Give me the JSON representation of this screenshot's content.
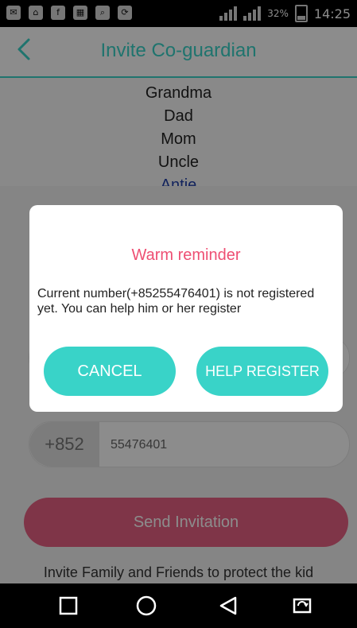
{
  "status_bar": {
    "battery": "32%",
    "time": "14:25",
    "icons": [
      "message-icon",
      "wifi-icon",
      "facebook-icon",
      "sim-icon",
      "search-icon",
      "sync-icon",
      "signal-icon",
      "battery-icon"
    ]
  },
  "header": {
    "title": "Invite Co-guardian",
    "back_icon": "back-arrow-icon"
  },
  "picker": {
    "items": [
      "Grandma",
      "Dad",
      "Mom",
      "Uncle",
      "Antie"
    ],
    "selected_index": 4
  },
  "form": {
    "country_code": "+852",
    "phone_value": "55476401",
    "send_label": "Send Invitation",
    "hint": "Invite Family and Friends to protect the kid"
  },
  "dialog": {
    "title": "Warm reminder",
    "message": "Current number(+85255476401)  is not registered yet. You can help him or her register",
    "cancel_label": "CANCEL",
    "help_label": "HELP REGISTER"
  },
  "nav": {
    "icons": [
      "recent-apps-icon",
      "home-icon",
      "back-icon",
      "screen-rotate-icon"
    ]
  },
  "colors": {
    "accent": "#39d3c8",
    "dialog_title": "#ee4f73",
    "send_button": "#e76283"
  }
}
